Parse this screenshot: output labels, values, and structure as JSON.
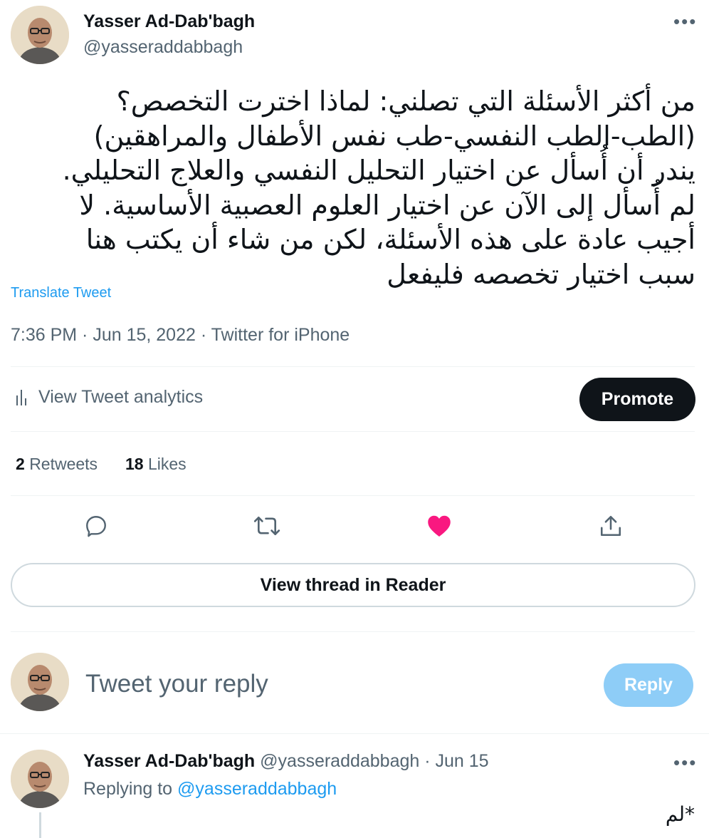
{
  "tweet": {
    "author": {
      "name": "Yasser Ad-Dab'bagh",
      "handle": "@yasseraddabbagh"
    },
    "more_icon": "ellipsis-icon",
    "text": "من أكثر الأسئلة التي تصلني: لماذا اخترت التخصص؟\n(الطب-الطب النفسي-طب نفس الأطفال والمراهقين)\nيندر أن أُسأل عن اختيار التحليل النفسي والعلاج التحليلي.\nلم أُسأل إلى الآن عن اختيار العلوم العصبية الأساسية. لا\nأجيب عادة على هذه الأسئلة، لكن من شاء أن يكتب هنا\nسبب اختيار تخصصه فليفعل",
    "translate_label": "Translate Tweet",
    "meta": "7:36 PM · Jun 15, 2022 · Twitter for iPhone"
  },
  "analytics": {
    "label": "View Tweet analytics",
    "icon": "analytics-bars-icon"
  },
  "promote_label": "Promote",
  "stats": {
    "retweets_count": "2",
    "retweets_label": "Retweets",
    "likes_count": "18",
    "likes_label": "Likes"
  },
  "actions": [
    {
      "name": "reply",
      "icon": "speech-bubble-icon"
    },
    {
      "name": "retweet",
      "icon": "retweet-arrows-icon"
    },
    {
      "name": "like",
      "icon": "heart-filled-icon",
      "active": true
    },
    {
      "name": "share",
      "icon": "share-upload-icon"
    }
  ],
  "thread_reader_label": "View thread in Reader",
  "composer": {
    "placeholder": "Tweet your reply",
    "reply_label": "Reply"
  },
  "reply": {
    "author_name": "Yasser Ad-Dab'bagh",
    "handle_date": "@yasseraddabbagh · Jun 15",
    "replying_prefix": "Replying to",
    "replying_to": "@yasseraddabbagh",
    "text": "*لم"
  },
  "colors": {
    "accent": "#1d9bf0",
    "like": "#f91880",
    "text": "#0f1419",
    "muted": "#536471",
    "divider": "#eff3f4",
    "reply_disabled": "#8ecdf7"
  }
}
